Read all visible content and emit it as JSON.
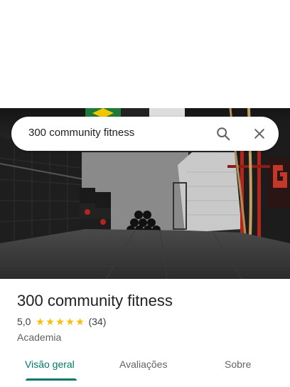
{
  "search": {
    "query": "300 community fitness"
  },
  "place": {
    "name": "300 community fitness",
    "rating": "5,0",
    "stars": 5,
    "review_count": "(34)",
    "category": "Academia"
  },
  "tabs": [
    {
      "label": "Visão geral",
      "active": true
    },
    {
      "label": "Avaliações",
      "active": false
    },
    {
      "label": "Sobre",
      "active": false
    }
  ],
  "colors": {
    "accent": "#00796b",
    "star": "#fbbc04"
  },
  "icons": {
    "search": "search-icon",
    "close": "close-icon",
    "star": "star-icon"
  }
}
